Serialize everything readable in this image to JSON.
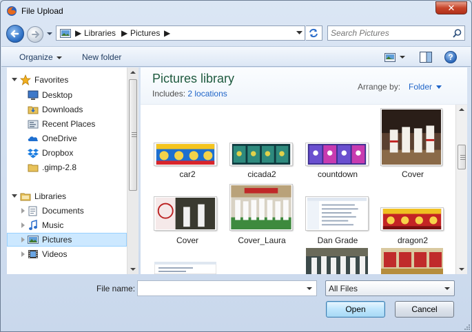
{
  "window": {
    "title": "File Upload",
    "close_glyph": "✕",
    "close_color": "#c7452a"
  },
  "address": {
    "crumbs": [
      "Libraries",
      "Pictures"
    ],
    "separator": "▶",
    "search_placeholder": "Search Pictures"
  },
  "toolbar": {
    "organize_label": "Organize",
    "new_folder_label": "New folder",
    "help_glyph": "?"
  },
  "nav": {
    "favorites": {
      "label": "Favorites",
      "items": [
        {
          "label": "Desktop",
          "icon": "desktop-icon"
        },
        {
          "label": "Downloads",
          "icon": "downloads-folder-icon"
        },
        {
          "label": "Recent Places",
          "icon": "recent-places-icon"
        },
        {
          "label": "OneDrive",
          "icon": "onedrive-icon"
        },
        {
          "label": "Dropbox",
          "icon": "dropbox-icon"
        },
        {
          "label": ".gimp-2.8",
          "icon": "folder-icon"
        }
      ]
    },
    "libraries": {
      "label": "Libraries",
      "items": [
        {
          "label": "Documents",
          "icon": "documents-library-icon",
          "selected": false
        },
        {
          "label": "Music",
          "icon": "music-library-icon",
          "selected": false
        },
        {
          "label": "Pictures",
          "icon": "pictures-library-icon",
          "selected": true
        },
        {
          "label": "Videos",
          "icon": "videos-library-icon",
          "selected": false
        }
      ]
    }
  },
  "library": {
    "title": "Pictures library",
    "includes_label": "Includes:",
    "includes_link": "2 locations",
    "arrange_label": "Arrange by:",
    "arrange_value": "Folder"
  },
  "files": [
    {
      "name": "car2"
    },
    {
      "name": "cicada2"
    },
    {
      "name": "countdown"
    },
    {
      "name": "Cover"
    },
    {
      "name": "Cover"
    },
    {
      "name": "Cover_Laura"
    },
    {
      "name": "Dan Grade"
    },
    {
      "name": "dragon2"
    }
  ],
  "footer": {
    "file_name_label": "File name:",
    "file_name_value": "",
    "filter_value": "All Files",
    "open_label": "Open",
    "cancel_label": "Cancel"
  },
  "colors": {
    "accent_link": "#1e64c8",
    "library_title": "#1e5a3e",
    "selection": "#cce8ff"
  }
}
